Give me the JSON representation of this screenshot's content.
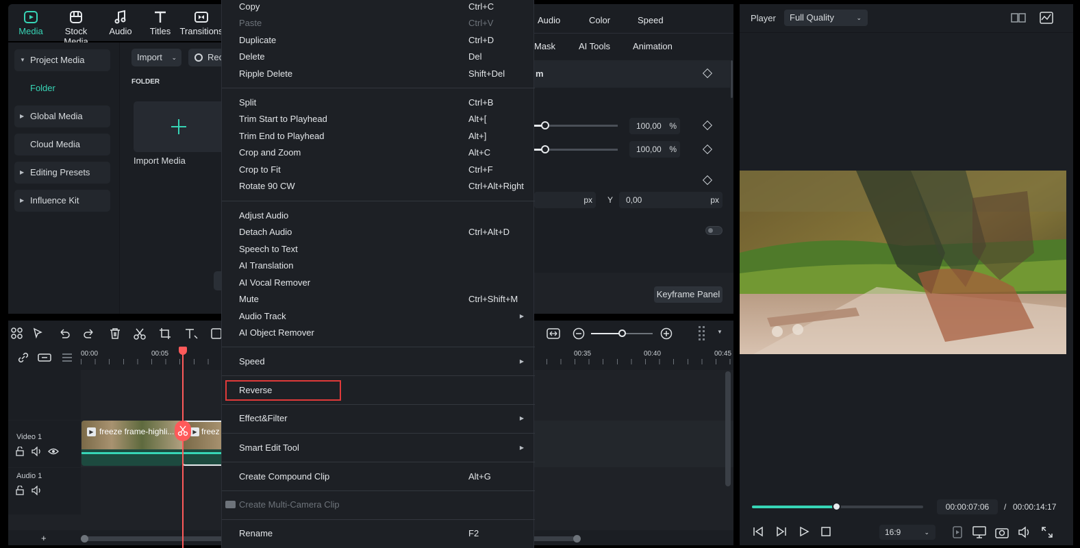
{
  "top_nav": {
    "items": [
      {
        "label": "Media",
        "icon": "media-icon",
        "active": true
      },
      {
        "label": "Stock Media",
        "icon": "stock-media-icon"
      },
      {
        "label": "Audio",
        "icon": "music-note-icon"
      },
      {
        "label": "Titles",
        "icon": "titles-icon"
      },
      {
        "label": "Transitions",
        "icon": "transitions-icon"
      }
    ]
  },
  "media_sidebar": {
    "items": [
      {
        "label": "Project Media",
        "expandable": true
      },
      {
        "label": "Folder",
        "expandable": false
      },
      {
        "label": "Global Media",
        "expandable": true
      },
      {
        "label": "Cloud Media",
        "expandable": false
      },
      {
        "label": "Editing Presets",
        "expandable": true
      },
      {
        "label": "Influence Kit",
        "expandable": true
      }
    ]
  },
  "media_panel": {
    "import_label": "Import",
    "record_label": "Rec",
    "folder_header": "FOLDER",
    "import_media_label": "Import Media"
  },
  "properties": {
    "tabs": [
      "Audio",
      "Color",
      "Speed"
    ],
    "subtabs": [
      "Mask",
      "AI Tools",
      "Animation"
    ],
    "section_title": "m",
    "scale_x": "100,00",
    "scale_y": "100,00",
    "percent": "%",
    "px_unit": "px",
    "y_label": "Y",
    "y_value": "0,00",
    "keyframe_panel_label": "Keyframe Panel"
  },
  "player": {
    "label": "Player",
    "quality": "Full Quality",
    "current_time": "00:00:07:06",
    "separator": "/",
    "total_time": "00:00:14:17",
    "aspect": "16:9",
    "progress": 0.49
  },
  "timeline": {
    "ruler_labels": [
      "00:00",
      "00:05",
      "00:35",
      "00:40",
      "00:45"
    ],
    "video_track_label": "Video 1",
    "audio_track_label": "Audio 1",
    "clip1_label": "freeze frame-highli...",
    "clip2_label": "freez",
    "add_label": "+"
  },
  "context_menu": {
    "groups": [
      [
        {
          "label": "Copy",
          "shortcut": "Ctrl+C"
        },
        {
          "label": "Paste",
          "shortcut": "Ctrl+V",
          "disabled": true
        },
        {
          "label": "Duplicate",
          "shortcut": "Ctrl+D"
        },
        {
          "label": "Delete",
          "shortcut": "Del"
        },
        {
          "label": "Ripple Delete",
          "shortcut": "Shift+Del"
        }
      ],
      [
        {
          "label": "Split",
          "shortcut": "Ctrl+B"
        },
        {
          "label": "Trim Start to Playhead",
          "shortcut": "Alt+["
        },
        {
          "label": "Trim End to Playhead",
          "shortcut": "Alt+]"
        },
        {
          "label": "Crop and Zoom",
          "shortcut": "Alt+C"
        },
        {
          "label": "Crop to Fit",
          "shortcut": "Ctrl+F"
        },
        {
          "label": "Rotate 90 CW",
          "shortcut": "Ctrl+Alt+Right"
        }
      ],
      [
        {
          "label": "Adjust Audio",
          "shortcut": ""
        },
        {
          "label": "Detach Audio",
          "shortcut": "Ctrl+Alt+D"
        },
        {
          "label": "Speech to Text",
          "shortcut": ""
        },
        {
          "label": "AI Translation",
          "shortcut": ""
        },
        {
          "label": "AI Vocal Remover",
          "shortcut": ""
        },
        {
          "label": "Mute",
          "shortcut": "Ctrl+Shift+M"
        },
        {
          "label": "Audio Track",
          "shortcut": "",
          "submenu": true
        },
        {
          "label": "AI Object Remover",
          "shortcut": ""
        }
      ],
      [
        {
          "label": "Speed",
          "shortcut": "",
          "submenu": true
        }
      ],
      [
        {
          "label": "Reverse",
          "shortcut": "",
          "highlighted": true
        }
      ],
      [
        {
          "label": "Effect&Filter",
          "shortcut": "",
          "submenu": true
        }
      ],
      [
        {
          "label": "Smart Edit Tool",
          "shortcut": "",
          "submenu": true
        }
      ],
      [
        {
          "label": "Create Compound Clip",
          "shortcut": "Alt+G"
        }
      ],
      [
        {
          "label": "Create Multi-Camera Clip",
          "shortcut": "",
          "disabled": true
        }
      ],
      [
        {
          "label": "Rename",
          "shortcut": "F2"
        }
      ]
    ]
  },
  "colors": {
    "accent": "#37d5b6",
    "highlight_border": "#e03a3a",
    "playhead": "#ff5a5a"
  }
}
